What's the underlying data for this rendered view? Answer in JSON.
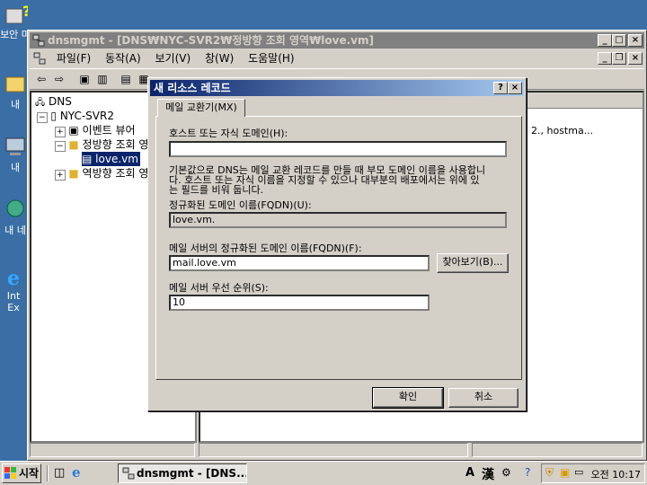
{
  "desktop": {
    "icons": [
      {
        "label": "보안 마",
        "icon": "help-security-icon"
      },
      {
        "label": "내",
        "icon": "my-documents-icon"
      },
      {
        "label": "내 ",
        "icon": "my-computer-icon"
      },
      {
        "label": "내 네",
        "icon": "my-network-icon"
      },
      {
        "label": "Int Ex",
        "icon": "internet-explorer-icon"
      }
    ]
  },
  "window": {
    "title": "dnsmgmt - [DNS₩NYC-SVR2₩정방향 조회 영역₩love.vm]",
    "menu": [
      "파일(F)",
      "동작(A)",
      "보기(V)",
      "창(W)",
      "도움말(H)"
    ],
    "tree": {
      "root": "DNS",
      "server": "NYC-SVR2",
      "event_viewer": "이벤트 뷰어",
      "forward_zone": "정방향 조회 영",
      "zone_item": "love.vm",
      "reverse_zone": "역방향 조회 영"
    },
    "right_pane_text": "2., hostma..."
  },
  "dialog": {
    "title": "새 리소스 레코드",
    "help_btn": "?",
    "close_btn": "×",
    "tab_label": "메일 교환기(MX)",
    "host_label": "호스트 또는 자식 도메인(H):",
    "host_value": "",
    "info_text_1": "기본값으로 DNS는 메일 교환 레코드를 만들 때 부모 도메인 이름을 사용합니",
    "info_text_2": "다. 호스트 또는 자식 이름을 지정할 수 있으나 대부분의 배포에서는 위에 있",
    "info_text_3": "는 필드를 비워 둡니다.",
    "fqdn_label": "정규화된 도메인 이름(FQDN)(U):",
    "fqdn_value": "love.vm.",
    "mail_server_label": "메일 서버의 정규화된 도메인 이름(FQDN)(F):",
    "mail_server_value": "mail.love.vm",
    "browse_btn": "찾아보기(B)...",
    "priority_label": "메일 서버 우선 순위(S):",
    "priority_value": "10",
    "ok_btn": "확인",
    "cancel_btn": "취소"
  },
  "taskbar": {
    "start_label": "시작",
    "task_label": "dnsmgmt - [DNS...",
    "ime_a": "A",
    "ime_han": "漢",
    "clock": "오전 10:17"
  }
}
